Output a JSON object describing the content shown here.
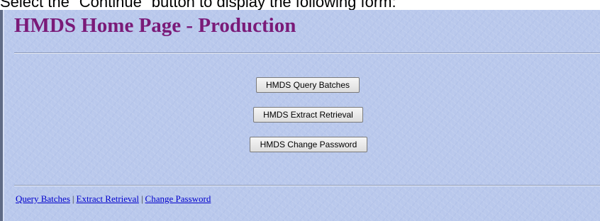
{
  "caption": "Select the \"Continue\" button to display the following form:",
  "page": {
    "title": "HMDS Home Page - Production"
  },
  "buttons": {
    "query_batches": "HMDS Query Batches",
    "extract_retrieval": "HMDS Extract Retrieval",
    "change_password": "HMDS Change Password"
  },
  "footer_links": {
    "query_batches": "Query Batches",
    "extract_retrieval": "Extract Retrieval",
    "change_password": "Change Password",
    "separator": "|"
  },
  "colors": {
    "background": "#b9c8ec",
    "title": "#7a1a78",
    "link": "#0000cc"
  }
}
